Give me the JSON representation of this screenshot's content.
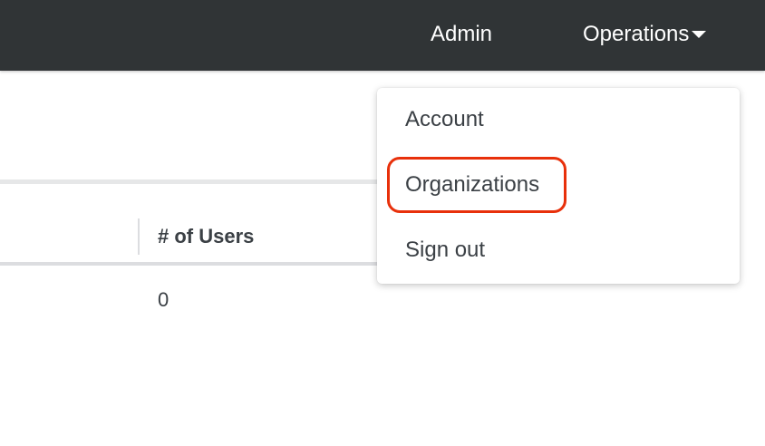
{
  "topbar": {
    "admin_label": "Admin",
    "operations_label": "Operations",
    "background": "#303436"
  },
  "table": {
    "column_header": "# of Users",
    "rows": [
      {
        "users": "0"
      }
    ]
  },
  "dropdown": {
    "items": [
      {
        "label": "Account"
      },
      {
        "label": "Organizations"
      },
      {
        "label": "Sign out"
      }
    ],
    "highlight_color": "#e8300b"
  }
}
